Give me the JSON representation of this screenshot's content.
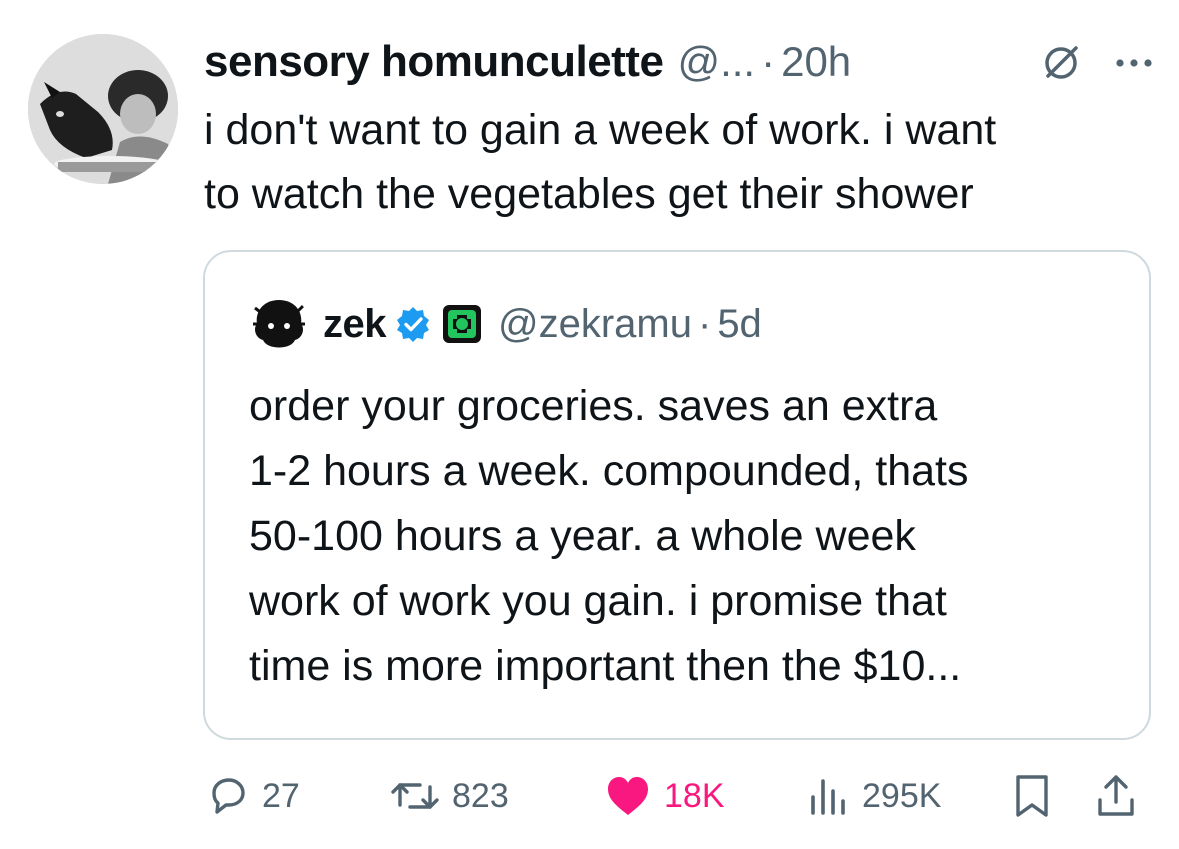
{
  "tweet": {
    "display_name": "sensory homunculette",
    "handle": "@...",
    "separator": "·",
    "time": "20h",
    "text": "i don't want to gain a week of work. i want\nto watch the vegetables get their shower"
  },
  "quoted": {
    "display_name": "zek",
    "handle": "@zekramu",
    "separator": "·",
    "time": "5d",
    "text": "order your groceries. saves an extra\n1-2 hours a week. compounded, thats\n50-100 hours a year. a whole week\nwork of work you gain. i promise that\ntime is more important then the $10..."
  },
  "actions": {
    "replies": "27",
    "reposts": "823",
    "likes": "18K",
    "views": "295K"
  },
  "icons": [
    "no-replies-icon",
    "more-icon",
    "verified-badge-icon",
    "affiliation-badge-icon",
    "reply-icon",
    "repost-icon",
    "like-icon",
    "views-icon",
    "bookmark-icon",
    "share-icon"
  ],
  "colors": {
    "text": "#0f1419",
    "secondary": "#536471",
    "like": "#f91880",
    "verified": "#1d9bf0",
    "border": "#cfd9de"
  }
}
